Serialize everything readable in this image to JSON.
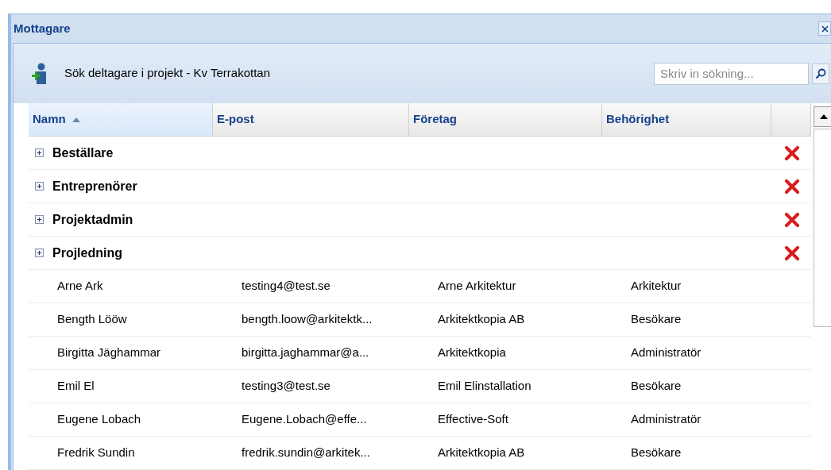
{
  "window": {
    "title": "Mottagare"
  },
  "toolbar": {
    "label": "Sök deltagare i projekt - Kv Terrakottan",
    "search": {
      "placeholder": "Skriv in sökning..."
    }
  },
  "table": {
    "columns": [
      {
        "label": "Namn",
        "sorted": true
      },
      {
        "label": "E-post",
        "sorted": false
      },
      {
        "label": "Företag",
        "sorted": false
      },
      {
        "label": "Behörighet",
        "sorted": false
      }
    ],
    "groups": [
      {
        "name": "Beställare",
        "expanded": false
      },
      {
        "name": "Entreprenörer",
        "expanded": false
      },
      {
        "name": "Projektadmin",
        "expanded": false
      },
      {
        "name": "Projledning",
        "expanded": false
      }
    ],
    "rows": [
      [
        "Arne Ark",
        "testing4@test.se",
        "Arne Arkitektur",
        "Arkitektur"
      ],
      [
        "Bength Lööw",
        "bength.loow@arkitektk...",
        "Arkitektkopia AB",
        "Besökare"
      ],
      [
        "Birgitta Jäghammar",
        "birgitta.jaghammar@a...",
        "Arkitektkopia",
        "Administratör"
      ],
      [
        "Emil El",
        "testing3@test.se",
        "Emil Elinstallation",
        "Besökare"
      ],
      [
        "Eugene Lobach",
        "Eugene.Lobach@effe...",
        "Effective-Soft",
        "Administratör"
      ],
      [
        "Fredrik Sundin",
        "fredrik.sundin@arkitek...",
        "Arkitektkopia AB",
        "Besökare"
      ]
    ]
  }
}
